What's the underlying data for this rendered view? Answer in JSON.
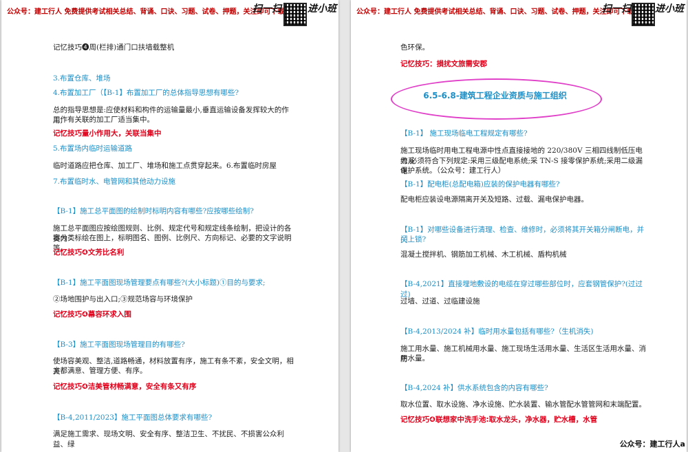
{
  "banner": {
    "text": "公众号：建工行人 免费提供考试相关总结、背诵、口诀、习题、试卷、押题，关注即可下载!",
    "scan_label": "扫一扫",
    "enter_label": "进小班"
  },
  "left": {
    "lines": [
      {
        "text": "记忆技巧❹周(栏排)通门口扶墙载整机",
        "kind": "body"
      },
      {
        "text": "3.布置仓库、堆场",
        "kind": "q"
      },
      {
        "text": "4.布置加工厂（【B-1】布置加工厂的总体指导思想有哪些?",
        "kind": "q"
      },
      {
        "text": "总的指导思想是:应使材料和构件的运输量最小,垂直运输设备发挥较大的作用,",
        "kind": "body"
      },
      {
        "text": "工作有关联的加工厂适当集中。",
        "kind": "body"
      },
      {
        "text": "记忆技巧量小作用大，关联当集中",
        "kind": "tip"
      },
      {
        "text": "5.布置场内临时运输道路",
        "kind": "q"
      },
      {
        "text": "临时道路应把仓库、加工厂、堆场和施工点贯穿起来。6.布置临时房屋",
        "kind": "body"
      },
      {
        "text": "7.布置临时水、电管网和其他动力设施",
        "kind": "q"
      },
      {
        "text": "【B-1】施工总平面图的绘制时标明内容有哪些?应按哪些绘制?",
        "kind": "q"
      },
      {
        "text": "施工总平面图应按绘图规则、比例、规定代号和规定线条绘制，把设计的各类内",
        "kind": "body"
      },
      {
        "text": "容分类标绘在图上，标明图名、图例、比例尺、方向标记、必要的文字说明等。",
        "kind": "body"
      },
      {
        "text": "记忆技巧❹文芳比名利",
        "kind": "tip"
      },
      {
        "text": "【B-1】施工平面图现场管理要点有哪些?(大小标题)①目的与要求;",
        "kind": "q"
      },
      {
        "text": "②场地围护与出入口;③规范场容与环境保护",
        "kind": "body"
      },
      {
        "text": "记忆技巧❹幕容环求入围",
        "kind": "tip"
      },
      {
        "text": "【B-3】施工平面图现场管理目的有哪些?",
        "kind": "q"
      },
      {
        "text": "使场容美观、整洁,道路畅通，材料放置有序，施工有条不紊，安全文明，相关",
        "kind": "body"
      },
      {
        "text": "方都满意、管理方便、有序。",
        "kind": "body"
      },
      {
        "text": "记忆技巧❹洁美管材畅满意，安全有条又有序",
        "kind": "tip"
      },
      {
        "text": "【B-4,2011/2023】施工平面图总体要求有哪些?",
        "kind": "q"
      },
      {
        "text": "满足施工需求、现场文明、安全有序、整洁卫生、不扰民、不损害公众利益、绿",
        "kind": "body"
      }
    ]
  },
  "right": {
    "section_title": "6.5-6.8-建筑工程企业资质与施工组织",
    "lines": [
      {
        "text": "色环保。",
        "kind": "body"
      },
      {
        "text": "记忆技巧：損扰文旅需安郡",
        "kind": "tip"
      },
      {
        "text": "【B-1】 施工现场临电工程规定有哪些?",
        "kind": "q"
      },
      {
        "text": "施工现场临时用电工程电源中性点直接接地的 220/380V 三相四线制低压电力系",
        "kind": "body"
      },
      {
        "text": "统,必须符合下列规定:采用三级配电系统;采 TN-S 接零保护系统;采用二级漏电",
        "kind": "body"
      },
      {
        "text": "保护系统。（公众号：建工行人）",
        "kind": "body"
      },
      {
        "text": "【B-1】配电柜(总配电箱)应装的保护电器有哪些?",
        "kind": "q"
      },
      {
        "text": "配电柜应装设电源隔离开关及短路、过载、漏电保护电器。",
        "kind": "body"
      },
      {
        "text": "【B-1】对哪些设备进行清理、检查、维修时，必须将其开关箱分闸断电，并关",
        "kind": "q"
      },
      {
        "text": "门上锁?",
        "kind": "q"
      },
      {
        "text": "混凝土搅拌机、钢筋加工机械、木工机械、盾构机械",
        "kind": "body"
      },
      {
        "text": "【B-4,2021】直接埋地敷设的电缆在穿过哪些部位时，应套钢管保护?(过过过)",
        "kind": "q"
      },
      {
        "text": "过墙、过道、过临建设施",
        "kind": "body"
      },
      {
        "text": "【B-4,2013/2024 补】临时用水量包括有哪些?（生机消失)",
        "kind": "q"
      },
      {
        "text": "施工用水量、施工机械用水量、施工现场生活用水量、生活区生活用水量、消防",
        "kind": "body"
      },
      {
        "text": "用水量。",
        "kind": "body"
      },
      {
        "text": "【B-4,2024 补】供水系统包含的内容有哪些?",
        "kind": "q"
      },
      {
        "text": "取水位置、取水设施、净水设施、贮水装置、输水管配水管管网和末端配置。",
        "kind": "body"
      },
      {
        "text": "记忆技巧❹联想家中洗手池:取水龙头，净水器，贮水槽，水管",
        "kind": "tip"
      }
    ]
  },
  "footer": {
    "text": "公众号：建工行人a"
  },
  "colors": {
    "question": "#1c8fc7",
    "tip": "#e0001a",
    "oval": "#e040c8"
  }
}
